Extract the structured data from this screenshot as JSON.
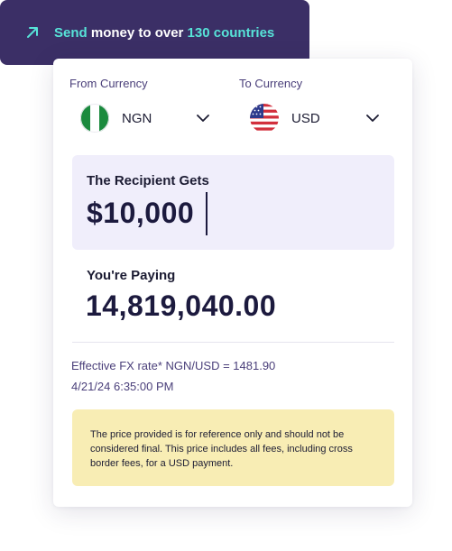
{
  "banner": {
    "part1": "Send",
    "part2": " money to over ",
    "part3": "130 countries",
    "icon": "arrow-up-right-icon",
    "accent_color": "#57e3d8",
    "bg_color": "#3b2f66"
  },
  "converter": {
    "from_label": "From Currency",
    "to_label": "To Currency",
    "from": {
      "code": "NGN",
      "flag": "nigeria-flag-icon"
    },
    "to": {
      "code": "USD",
      "flag": "usa-flag-icon"
    },
    "recipient_label": "The Recipient Gets",
    "recipient_amount": "$10,000",
    "paying_label": "You're Paying",
    "paying_amount": "14,819,040.00",
    "fx_rate": "Effective FX rate* NGN/USD = 1481.90",
    "timestamp": "4/21/24 6:35:00 PM",
    "notice": "The price provided is for reference only and should not be considered final. This price includes all fees, including cross border fees, for a USD payment.",
    "recipient_bg": "#f0eefb",
    "notice_bg": "#f8edb4"
  }
}
